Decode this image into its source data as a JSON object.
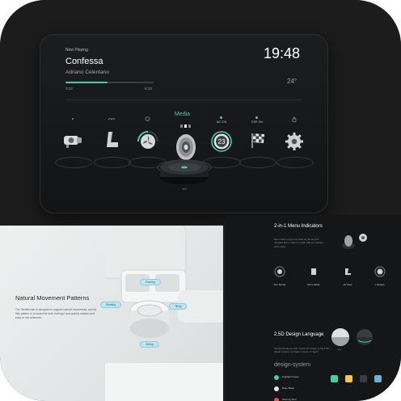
{
  "now_playing": {
    "label": "Now Playing",
    "song": "Confessa",
    "artist": "Adriano Celentano",
    "elapsed": "0:12",
    "duration": "5:10",
    "progress": 0.48
  },
  "status": {
    "clock": "19:48",
    "temperature": "24°"
  },
  "menu": {
    "active": "Media",
    "items": [
      {
        "name": "camera",
        "label": "",
        "icon": "camera-icon"
      },
      {
        "name": "seat",
        "label": "",
        "icon": "seat-icon"
      },
      {
        "name": "fan",
        "label": "",
        "icon": "fan-icon"
      },
      {
        "name": "media",
        "label": "Media",
        "icon": "speaker-icon"
      },
      {
        "name": "ac",
        "label": "A/C ON",
        "icon": "temperature-dial-icon",
        "value": "23"
      },
      {
        "name": "esp",
        "label": "ESP ON",
        "icon": "checkered-flag-icon"
      },
      {
        "name": "settings",
        "label": "",
        "icon": "gear-icon"
      }
    ]
  },
  "movement": {
    "title": "Natural Movement Patterns",
    "description": "The TactileKnob is designed to support natural movements, and its flick pattern is provided for both locking it and quickly rotation and easy to use wherever.",
    "pills": [
      "Pushing",
      "Rotating",
      "Tilting",
      "Sliding"
    ]
  },
  "menu_indicators": {
    "title": "2-in-1 Menu Indicators",
    "description": "Menu items come into view as the knob is dragged and a menu is made without needing extra steps.",
    "items": [
      {
        "name": "Fan Speed"
      },
      {
        "name": "Drive Mode"
      },
      {
        "name": "Air Flow"
      },
      {
        "name": "Lifestyle"
      }
    ]
  },
  "design_language": {
    "title": "2.5D Design Language",
    "description": "Showing features with volumetric shape of the 2.5D design system to create a sense of depth.",
    "system_label": "design-system",
    "rows": [
      {
        "label": "Highlight Green",
        "color": "#3fd2a4"
      },
      {
        "label": "Base Black",
        "color": "#e6e6e6"
      },
      {
        "label": "Warning Red",
        "color": "#e2564d"
      }
    ],
    "swatches": [
      "#3fd2a4",
      "#f2c744",
      "#3a3d40",
      "#6bb3d6"
    ]
  },
  "colors": {
    "accent": "#3fd2a4",
    "screen_bg": "#141618",
    "text_primary": "#ffffff"
  }
}
